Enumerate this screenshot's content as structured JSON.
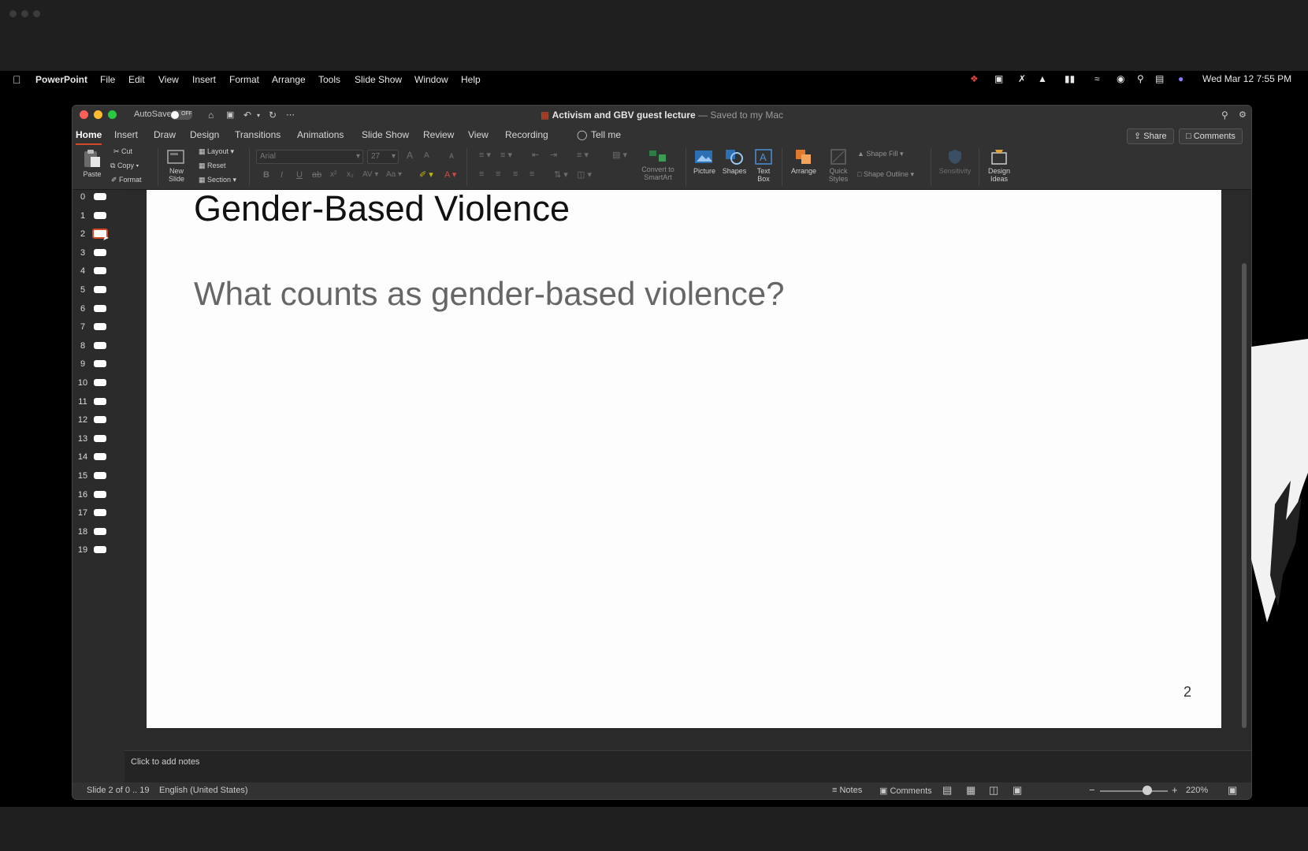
{
  "menubar": {
    "app": "PowerPoint",
    "items": [
      "File",
      "Edit",
      "View",
      "Insert",
      "Format",
      "Arrange",
      "Tools",
      "Slide Show",
      "Window",
      "Help"
    ],
    "datetime": "Wed Mar 12  7:55 PM"
  },
  "window": {
    "autosave_label": "AutoSave",
    "autosave_state": "OFF",
    "doc_name": "Activism and GBV guest lecture",
    "doc_status": "— Saved to my Mac"
  },
  "tabs": [
    "Home",
    "Insert",
    "Draw",
    "Design",
    "Transitions",
    "Animations",
    "Slide Show",
    "Review",
    "View",
    "Recording"
  ],
  "tell_me": "Tell me",
  "share_label": "Share",
  "comments_label": "Comments",
  "ribbon": {
    "paste": "Paste",
    "cut": "Cut",
    "copy": "Copy",
    "format": "Format",
    "new_slide": "New Slide",
    "layout": "Layout",
    "reset": "Reset",
    "section": "Section",
    "font_name": "Arial",
    "font_size": "27",
    "convert_smartart": "Convert to SmartArt",
    "picture": "Picture",
    "shapes": "Shapes",
    "text_box": "Text Box",
    "arrange": "Arrange",
    "quick_styles": "Quick Styles",
    "shape_fill": "Shape Fill",
    "shape_outline": "Shape Outline",
    "sensitivity": "Sensitivity",
    "design_ideas": "Design Ideas"
  },
  "thumbnails": [
    "0",
    "1",
    "2",
    "3",
    "4",
    "5",
    "6",
    "7",
    "8",
    "9",
    "10",
    "11",
    "12",
    "13",
    "14",
    "15",
    "16",
    "17",
    "18",
    "19"
  ],
  "selected_slide_index": 2,
  "slide": {
    "title": "Gender-Based Violence",
    "body": "What counts as gender-based violence?",
    "number": "2"
  },
  "notes_placeholder": "Click to add notes",
  "status": {
    "slide_info": "Slide 2 of 0 .. 19",
    "language": "English (United States)",
    "notes": "Notes",
    "comments": "Comments",
    "zoom": "220%"
  },
  "colors": {
    "accent": "#d24726",
    "slide_bg": "#fdfdfd",
    "body_text": "#666666"
  }
}
